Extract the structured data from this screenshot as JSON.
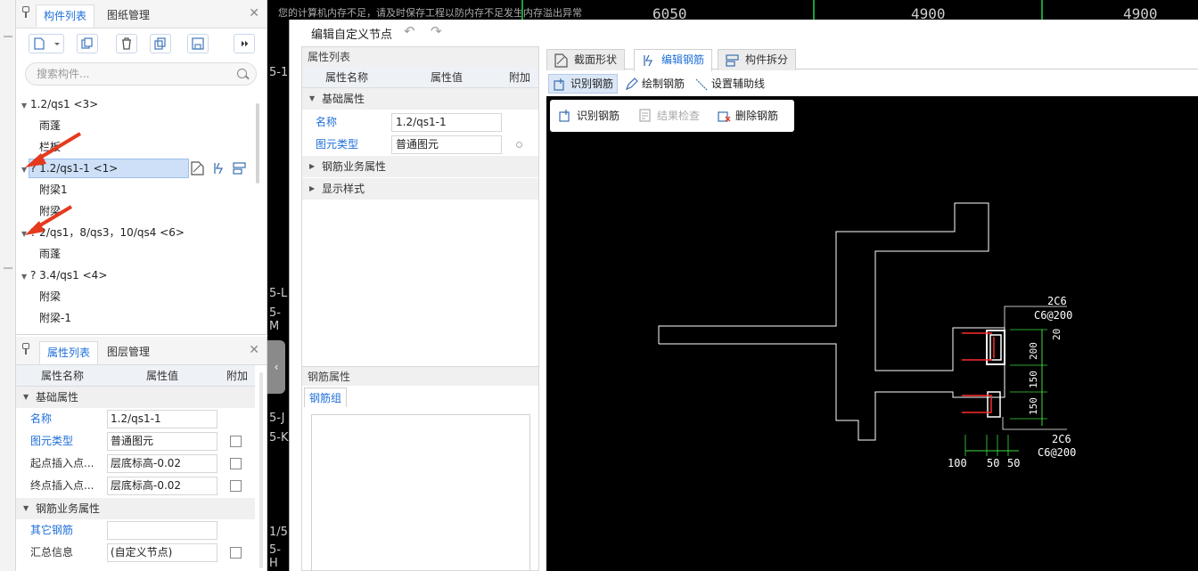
{
  "component_panel": {
    "tabs": [
      "构件列表",
      "图纸管理"
    ],
    "search_placeholder": "搜索构件...",
    "tree": [
      {
        "label": "1.2/qs1 <3>",
        "level": 0,
        "expanded": true
      },
      {
        "label": "雨蓬",
        "level": 1
      },
      {
        "label": "栏板",
        "level": 1
      },
      {
        "label": "? 1.2/qs1-1 <1>",
        "level": 0,
        "expanded": true,
        "selected": true
      },
      {
        "label": "附梁1",
        "level": 1
      },
      {
        "label": "附梁",
        "level": 1
      },
      {
        "label": "? 2/qs1，8/qs3，10/qs4 <6>",
        "level": 0,
        "expanded": true
      },
      {
        "label": "雨蓬",
        "level": 1
      },
      {
        "label": "? 3.4/qs1 <4>",
        "level": 0,
        "expanded": true
      },
      {
        "label": "附梁",
        "level": 1
      },
      {
        "label": "附梁-1",
        "level": 1
      }
    ]
  },
  "property_panel": {
    "tabs": [
      "属性列表",
      "图层管理"
    ],
    "columns": [
      "属性名称",
      "属性值",
      "附加"
    ],
    "groups": [
      {
        "label": "基础属性",
        "rows": [
          {
            "name": "名称",
            "value": "1.2/qs1-1",
            "blue": true,
            "checkbox": false
          },
          {
            "name": "图元类型",
            "value": "普通图元",
            "blue": true,
            "checkbox": true
          },
          {
            "name": "起点插入点...",
            "value": "层底标高-0.02",
            "blue": false,
            "checkbox": true
          },
          {
            "name": "终点插入点...",
            "value": "层底标高-0.02",
            "blue": false,
            "checkbox": true
          }
        ]
      },
      {
        "label": "钢筋业务属性",
        "rows": [
          {
            "name": "其它钢筋",
            "value": "",
            "blue": true,
            "checkbox": false
          },
          {
            "name": "汇总信息",
            "value": "(自定义节点)",
            "blue": false,
            "checkbox": true
          }
        ]
      }
    ]
  },
  "background": {
    "numbers": [
      "6050",
      "4900",
      "4900"
    ],
    "message": "您的计算机内存不足，请及时保存工程以防内存不足发生内存溢出异常",
    "side_labels": [
      "5-1",
      "5-L",
      "5-M",
      "5-J",
      "5-K",
      "1/5",
      "5-H"
    ]
  },
  "dialog": {
    "title": "编辑自定义节点",
    "attr_list": {
      "header": "属性列表",
      "columns": [
        "属性名称",
        "属性值",
        "附加"
      ],
      "groups": [
        {
          "label": "基础属性",
          "expanded": true,
          "rows": [
            {
              "name": "名称",
              "value": "1.2/qs1-1",
              "dot": false
            },
            {
              "name": "图元类型",
              "value": "普通图元",
              "dot": true
            }
          ]
        },
        {
          "label": "钢筋业务属性",
          "expanded": false
        },
        {
          "label": "显示样式",
          "expanded": false
        }
      ],
      "rebar_attr_header": "钢筋属性",
      "rebar_group_tab": "钢筋组"
    },
    "tabs": [
      {
        "label": "截面形状",
        "active": false
      },
      {
        "label": "编辑钢筋",
        "active": true
      },
      {
        "label": "构件拆分",
        "active": false
      }
    ],
    "toolbar": [
      {
        "label": "识别钢筋",
        "active": true
      },
      {
        "label": "绘制钢筋",
        "active": false
      },
      {
        "label": "设置辅助线",
        "active": false
      }
    ],
    "float_bar": [
      {
        "label": "识别钢筋",
        "enabled": true
      },
      {
        "label": "结果检查",
        "enabled": false
      },
      {
        "label": "删除钢筋",
        "enabled": true
      }
    ],
    "cad_annotations": {
      "top_rebar": "2C6",
      "top_stirrup": "C6@200",
      "bottom_rebar": "2C6",
      "bottom_stirrup": "C6@200",
      "dim_20": "20",
      "dim_200": "200",
      "dim_150a": "150",
      "dim_150b": "150",
      "dim_100": "100",
      "dim_50a": "50",
      "dim_50b": "50"
    }
  },
  "colors": {
    "accent": "#1e6fd9",
    "cad_white": "#ffffff",
    "cad_green": "#3ddc3d",
    "cad_red": "#ff2a2a",
    "selection": "#cde0f7"
  }
}
